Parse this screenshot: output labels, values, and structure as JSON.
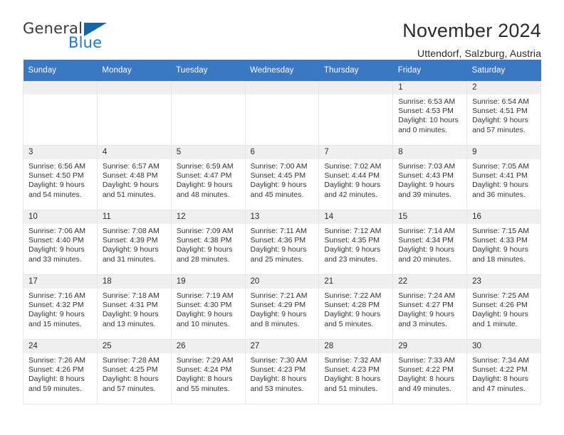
{
  "brand": {
    "line1": "General",
    "line2": "Blue",
    "triangle_icon": "triangle-icon",
    "color_dark": "#3b3b3b",
    "color_blue": "#1e7bc4"
  },
  "header": {
    "title": "November 2024",
    "subtitle": "Uttendorf, Salzburg, Austria"
  },
  "theme": {
    "header_bar": "#3b78c3",
    "daynum_strip": "#f0f0f0",
    "cell_border": "#e6e6e6",
    "text": "#2b2b2b"
  },
  "calendar": {
    "weekday_headers": [
      "Sunday",
      "Monday",
      "Tuesday",
      "Wednesday",
      "Thursday",
      "Friday",
      "Saturday"
    ],
    "weeks": [
      [
        {
          "day": "",
          "empty": true
        },
        {
          "day": "",
          "empty": true
        },
        {
          "day": "",
          "empty": true
        },
        {
          "day": "",
          "empty": true
        },
        {
          "day": "",
          "empty": true
        },
        {
          "day": "1",
          "sunrise": "Sunrise: 6:53 AM",
          "sunset": "Sunset: 4:53 PM",
          "daylight": "Daylight: 10 hours and 0 minutes."
        },
        {
          "day": "2",
          "sunrise": "Sunrise: 6:54 AM",
          "sunset": "Sunset: 4:51 PM",
          "daylight": "Daylight: 9 hours and 57 minutes."
        }
      ],
      [
        {
          "day": "3",
          "sunrise": "Sunrise: 6:56 AM",
          "sunset": "Sunset: 4:50 PM",
          "daylight": "Daylight: 9 hours and 54 minutes."
        },
        {
          "day": "4",
          "sunrise": "Sunrise: 6:57 AM",
          "sunset": "Sunset: 4:48 PM",
          "daylight": "Daylight: 9 hours and 51 minutes."
        },
        {
          "day": "5",
          "sunrise": "Sunrise: 6:59 AM",
          "sunset": "Sunset: 4:47 PM",
          "daylight": "Daylight: 9 hours and 48 minutes."
        },
        {
          "day": "6",
          "sunrise": "Sunrise: 7:00 AM",
          "sunset": "Sunset: 4:45 PM",
          "daylight": "Daylight: 9 hours and 45 minutes."
        },
        {
          "day": "7",
          "sunrise": "Sunrise: 7:02 AM",
          "sunset": "Sunset: 4:44 PM",
          "daylight": "Daylight: 9 hours and 42 minutes."
        },
        {
          "day": "8",
          "sunrise": "Sunrise: 7:03 AM",
          "sunset": "Sunset: 4:43 PM",
          "daylight": "Daylight: 9 hours and 39 minutes."
        },
        {
          "day": "9",
          "sunrise": "Sunrise: 7:05 AM",
          "sunset": "Sunset: 4:41 PM",
          "daylight": "Daylight: 9 hours and 36 minutes."
        }
      ],
      [
        {
          "day": "10",
          "sunrise": "Sunrise: 7:06 AM",
          "sunset": "Sunset: 4:40 PM",
          "daylight": "Daylight: 9 hours and 33 minutes."
        },
        {
          "day": "11",
          "sunrise": "Sunrise: 7:08 AM",
          "sunset": "Sunset: 4:39 PM",
          "daylight": "Daylight: 9 hours and 31 minutes."
        },
        {
          "day": "12",
          "sunrise": "Sunrise: 7:09 AM",
          "sunset": "Sunset: 4:38 PM",
          "daylight": "Daylight: 9 hours and 28 minutes."
        },
        {
          "day": "13",
          "sunrise": "Sunrise: 7:11 AM",
          "sunset": "Sunset: 4:36 PM",
          "daylight": "Daylight: 9 hours and 25 minutes."
        },
        {
          "day": "14",
          "sunrise": "Sunrise: 7:12 AM",
          "sunset": "Sunset: 4:35 PM",
          "daylight": "Daylight: 9 hours and 23 minutes."
        },
        {
          "day": "15",
          "sunrise": "Sunrise: 7:14 AM",
          "sunset": "Sunset: 4:34 PM",
          "daylight": "Daylight: 9 hours and 20 minutes."
        },
        {
          "day": "16",
          "sunrise": "Sunrise: 7:15 AM",
          "sunset": "Sunset: 4:33 PM",
          "daylight": "Daylight: 9 hours and 18 minutes."
        }
      ],
      [
        {
          "day": "17",
          "sunrise": "Sunrise: 7:16 AM",
          "sunset": "Sunset: 4:32 PM",
          "daylight": "Daylight: 9 hours and 15 minutes."
        },
        {
          "day": "18",
          "sunrise": "Sunrise: 7:18 AM",
          "sunset": "Sunset: 4:31 PM",
          "daylight": "Daylight: 9 hours and 13 minutes."
        },
        {
          "day": "19",
          "sunrise": "Sunrise: 7:19 AM",
          "sunset": "Sunset: 4:30 PM",
          "daylight": "Daylight: 9 hours and 10 minutes."
        },
        {
          "day": "20",
          "sunrise": "Sunrise: 7:21 AM",
          "sunset": "Sunset: 4:29 PM",
          "daylight": "Daylight: 9 hours and 8 minutes."
        },
        {
          "day": "21",
          "sunrise": "Sunrise: 7:22 AM",
          "sunset": "Sunset: 4:28 PM",
          "daylight": "Daylight: 9 hours and 5 minutes."
        },
        {
          "day": "22",
          "sunrise": "Sunrise: 7:24 AM",
          "sunset": "Sunset: 4:27 PM",
          "daylight": "Daylight: 9 hours and 3 minutes."
        },
        {
          "day": "23",
          "sunrise": "Sunrise: 7:25 AM",
          "sunset": "Sunset: 4:26 PM",
          "daylight": "Daylight: 9 hours and 1 minute."
        }
      ],
      [
        {
          "day": "24",
          "sunrise": "Sunrise: 7:26 AM",
          "sunset": "Sunset: 4:26 PM",
          "daylight": "Daylight: 8 hours and 59 minutes."
        },
        {
          "day": "25",
          "sunrise": "Sunrise: 7:28 AM",
          "sunset": "Sunset: 4:25 PM",
          "daylight": "Daylight: 8 hours and 57 minutes."
        },
        {
          "day": "26",
          "sunrise": "Sunrise: 7:29 AM",
          "sunset": "Sunset: 4:24 PM",
          "daylight": "Daylight: 8 hours and 55 minutes."
        },
        {
          "day": "27",
          "sunrise": "Sunrise: 7:30 AM",
          "sunset": "Sunset: 4:23 PM",
          "daylight": "Daylight: 8 hours and 53 minutes."
        },
        {
          "day": "28",
          "sunrise": "Sunrise: 7:32 AM",
          "sunset": "Sunset: 4:23 PM",
          "daylight": "Daylight: 8 hours and 51 minutes."
        },
        {
          "day": "29",
          "sunrise": "Sunrise: 7:33 AM",
          "sunset": "Sunset: 4:22 PM",
          "daylight": "Daylight: 8 hours and 49 minutes."
        },
        {
          "day": "30",
          "sunrise": "Sunrise: 7:34 AM",
          "sunset": "Sunset: 4:22 PM",
          "daylight": "Daylight: 8 hours and 47 minutes."
        }
      ]
    ]
  }
}
